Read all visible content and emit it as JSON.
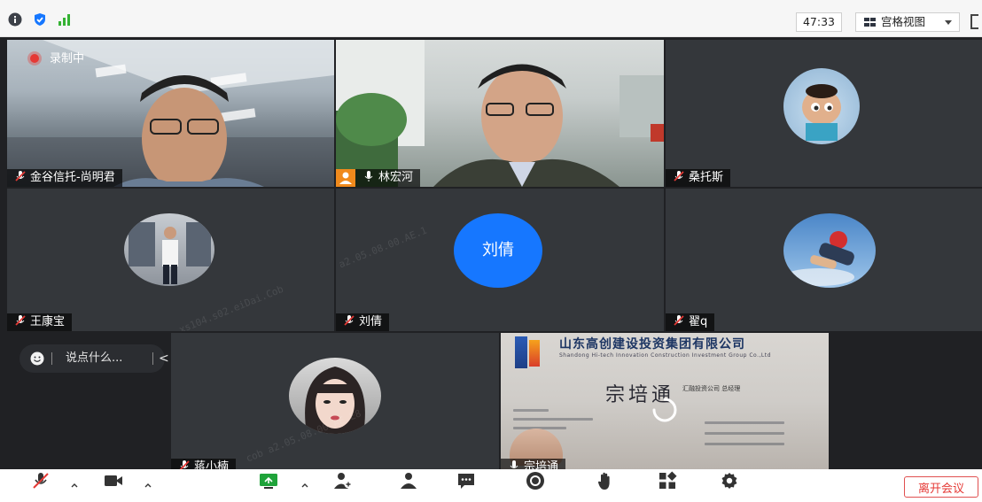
{
  "topbar": {
    "timer": "47:33",
    "view_label": "宫格视图",
    "icons": [
      "info-icon",
      "shield-icon",
      "signal-bars-icon",
      "fullscreen-icon"
    ]
  },
  "recording_label": "录制中",
  "participants": [
    {
      "name": "金谷信托-尚明君",
      "type": "video",
      "muted": true
    },
    {
      "name": "林宏河",
      "type": "video",
      "muted": false,
      "host": true
    },
    {
      "name": "桑托斯",
      "type": "avatar",
      "muted": true
    },
    {
      "name": "王康宝",
      "type": "avatar",
      "muted": true
    },
    {
      "name": "刘倩",
      "type": "initials",
      "initials": "刘倩",
      "muted": true
    },
    {
      "name": "翟q",
      "type": "avatar",
      "muted": true
    },
    {
      "name": "蒋小楠",
      "type": "avatar",
      "muted": true
    },
    {
      "name": "宗培通",
      "type": "video",
      "muted": false
    }
  ],
  "business_card": {
    "company": "山东高创建设投资集团有限公司",
    "company_en": "Shandong Hi-tech Innovation Construction Investment Group Co.,Ltd",
    "person": "宗培通",
    "role": "汇融投资公司 总经理"
  },
  "chat": {
    "placeholder": "说点什么..."
  },
  "toolbar": {
    "leave_label": "离开会议"
  },
  "colors": {
    "initials_bg": "#1677ff",
    "leave_red": "#e53935",
    "host_orange": "#f08a1c",
    "rec_red": "#e53935"
  }
}
